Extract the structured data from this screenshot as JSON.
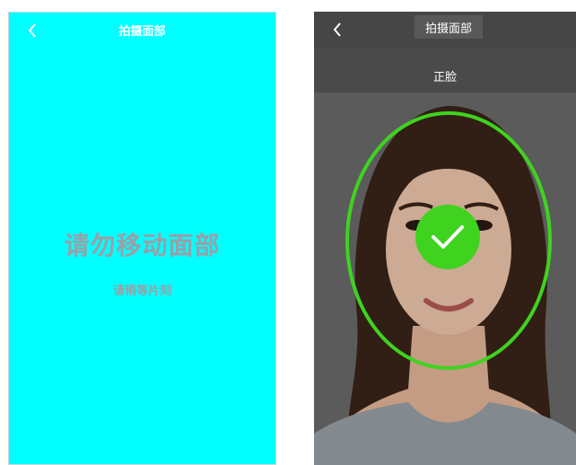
{
  "left_screen": {
    "title": "拍摄面部",
    "back_icon": "chevron-left-icon",
    "main_message": "请勿移动面部",
    "sub_message": "请稍等片刻",
    "background": "#00ffff"
  },
  "right_screen": {
    "title": "拍摄面部",
    "back_icon": "chevron-left-icon",
    "face_label": "正脸",
    "status_icon": "check-icon",
    "accent": "#3fd31f"
  }
}
